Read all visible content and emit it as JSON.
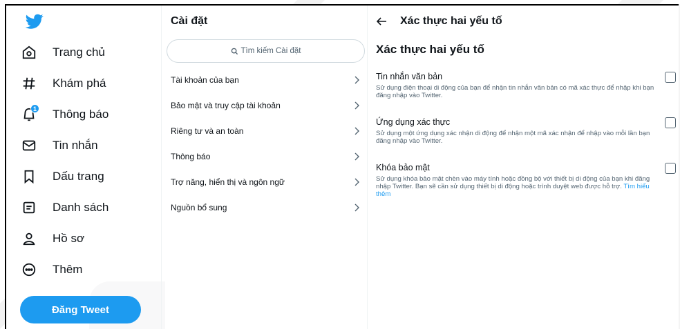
{
  "nav": {
    "items": [
      {
        "label": "Trang chủ",
        "icon": "home-icon"
      },
      {
        "label": "Khám phá",
        "icon": "hashtag-icon"
      },
      {
        "label": "Thông báo",
        "icon": "bell-icon",
        "badge": "1"
      },
      {
        "label": "Tin nhắn",
        "icon": "mail-icon"
      },
      {
        "label": "Dấu trang",
        "icon": "bookmark-icon"
      },
      {
        "label": "Danh sách",
        "icon": "list-icon"
      },
      {
        "label": "Hồ sơ",
        "icon": "profile-icon"
      },
      {
        "label": "Thêm",
        "icon": "more-icon"
      }
    ],
    "tweet_button": "Đăng Tweet"
  },
  "settings": {
    "title": "Cài đặt",
    "search_placeholder": "Tìm kiếm Cài đặt",
    "items": [
      {
        "label": "Tài khoản của bạn"
      },
      {
        "label": "Bảo mật và truy cập tài khoản"
      },
      {
        "label": "Riêng tư và an toàn"
      },
      {
        "label": "Thông báo"
      },
      {
        "label": "Trợ năng, hiển thị và ngôn ngữ"
      },
      {
        "label": "Nguồn bổ sung"
      }
    ]
  },
  "detail": {
    "header": "Xác thực hai yếu tố",
    "title": "Xác thực hai yếu tố",
    "options": [
      {
        "title": "Tin nhắn văn bản",
        "desc": "Sử dụng điện thoại di động của bạn để nhận tin nhắn văn bản có mã xác thực để nhập khi bạn đăng nhập vào Twitter.",
        "checked": false
      },
      {
        "title": "Ứng dụng xác thực",
        "desc": "Sử dụng một ứng dụng xác nhận di động để nhận một mã xác nhận để nhập vào mỗi lần bạn đăng nhập vào Twitter.",
        "checked": false
      },
      {
        "title": "Khóa bảo mật",
        "desc": "Sử dụng khóa bảo mật chèn vào máy tính hoặc đồng bộ với thiết bị di động của bạn khi đăng nhập Twitter. Bạn sẽ cần sử dụng thiết bị di động hoặc trình duyệt web được hỗ trợ.",
        "link": "Tìm hiểu thêm",
        "checked": false
      }
    ]
  },
  "colors": {
    "accent": "#1d9bf0",
    "text": "#0f1419",
    "secondary": "#536471",
    "border": "#cfd9de"
  }
}
